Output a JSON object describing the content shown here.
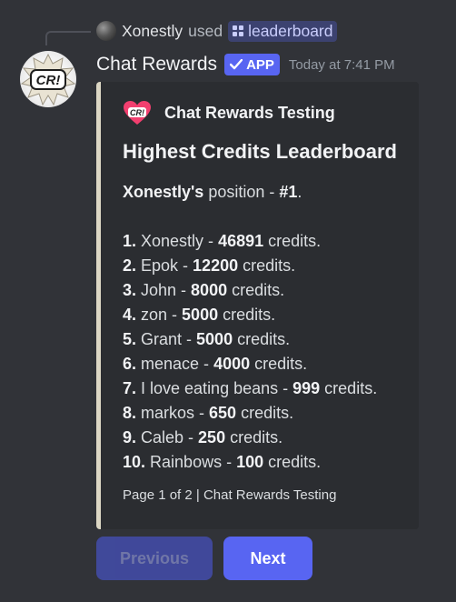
{
  "reply": {
    "user": "Xonestly",
    "used_text": "used",
    "command": "leaderboard"
  },
  "message": {
    "bot_name": "Chat Rewards",
    "badge": "APP",
    "timestamp": "Today at 7:41 PM",
    "avatar_text": "CR!"
  },
  "embed": {
    "accent_color": "#dcd7c4",
    "author_icon_text": "CR!",
    "author_name": "Chat Rewards Testing",
    "title": "Highest Credits Leaderboard",
    "position_user": "Xonestly's",
    "position_text": " position - ",
    "position_rank": "#1",
    "position_end": ".",
    "entries": [
      {
        "rank": "1.",
        "name": " Xonestly - ",
        "credits": "46891",
        "suffix": " credits."
      },
      {
        "rank": "2.",
        "name": " Epok - ",
        "credits": "12200",
        "suffix": " credits."
      },
      {
        "rank": "3.",
        "name": " John - ",
        "credits": "8000",
        "suffix": " credits."
      },
      {
        "rank": "4.",
        "name": " zon - ",
        "credits": "5000",
        "suffix": " credits."
      },
      {
        "rank": "5.",
        "name": " Grant - ",
        "credits": "5000",
        "suffix": " credits."
      },
      {
        "rank": "6.",
        "name": " menace - ",
        "credits": "4000",
        "suffix": " credits."
      },
      {
        "rank": "7.",
        "name": " I love eating beans - ",
        "credits": "999",
        "suffix": " credits."
      },
      {
        "rank": "8.",
        "name": " markos - ",
        "credits": "650",
        "suffix": " credits."
      },
      {
        "rank": "9.",
        "name": " Caleb - ",
        "credits": "250",
        "suffix": " credits."
      },
      {
        "rank": "10.",
        "name": " Rainbows - ",
        "credits": "100",
        "suffix": " credits."
      }
    ],
    "footer": "Page 1 of 2 | Chat Rewards Testing"
  },
  "buttons": {
    "previous": "Previous",
    "next": "Next"
  },
  "colors": {
    "background": "#313338",
    "embed_bg": "#2b2d31",
    "blurple": "#5865f2",
    "author_icon": "#f23f6f"
  }
}
